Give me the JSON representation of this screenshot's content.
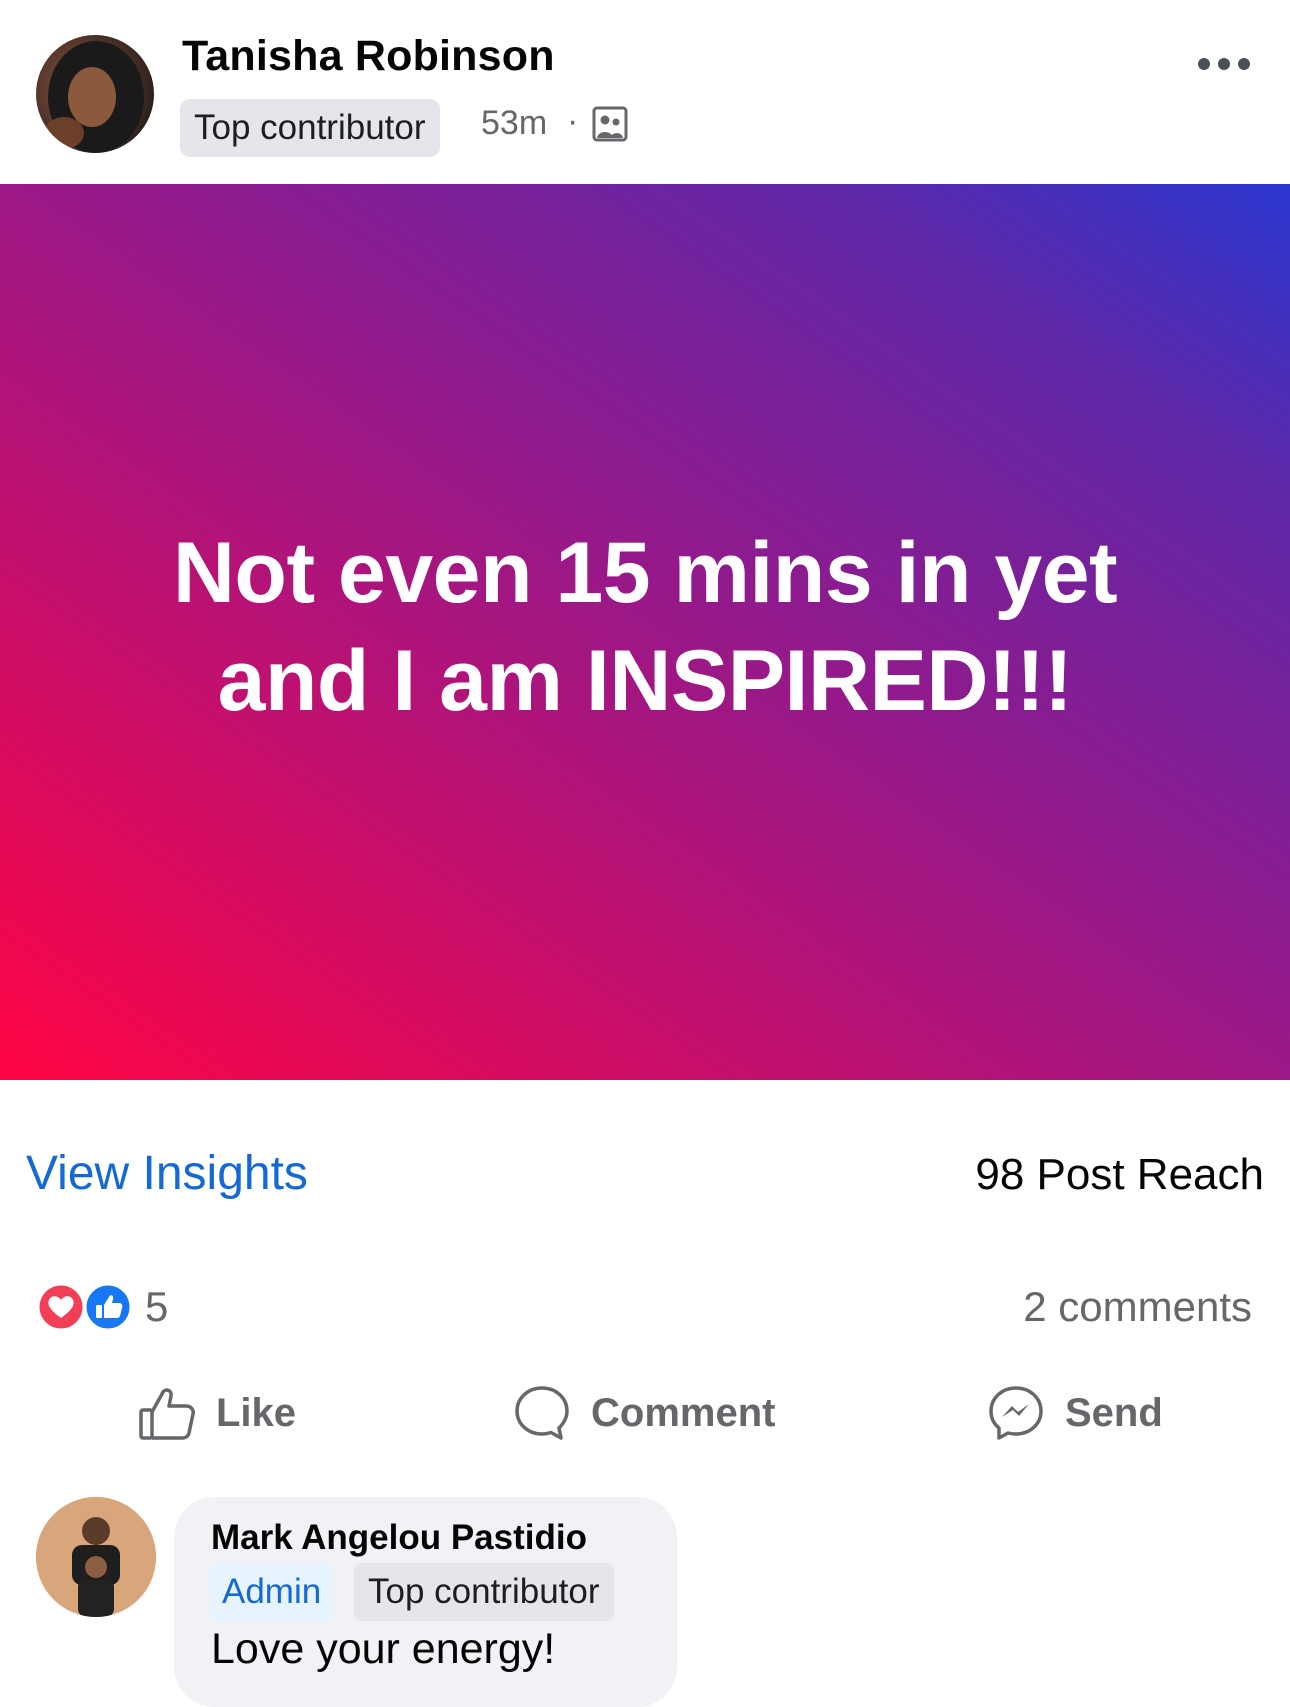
{
  "post": {
    "author": "Tanisha Robinson",
    "author_badge": "Top contributor",
    "time": "53m",
    "separator": "·",
    "audience_icon": "group-icon",
    "more_icon": "more-horizontal-icon",
    "text_lines": [
      "Not even 15 mins in yet",
      "and I am INSPIRED!!!"
    ],
    "background": {
      "from": "#ff0444",
      "to": "#2a36cf"
    }
  },
  "insights": {
    "link_label": "View Insights",
    "reach": "98 Post Reach"
  },
  "reactions": {
    "icons": [
      "love-reaction-icon",
      "like-reaction-icon"
    ],
    "count": "5",
    "comments": "2 comments"
  },
  "actions": {
    "like": "Like",
    "comment": "Comment",
    "send": "Send"
  },
  "comment": {
    "author": "Mark Angelou Pastidio",
    "badge_admin": "Admin",
    "badge_top": "Top contributor",
    "text": "Love your energy!"
  },
  "colors": {
    "link_blue": "#1569d6",
    "secondary_text": "#65676b",
    "love_red": "#f33e58",
    "like_blue": "#1877f2"
  }
}
